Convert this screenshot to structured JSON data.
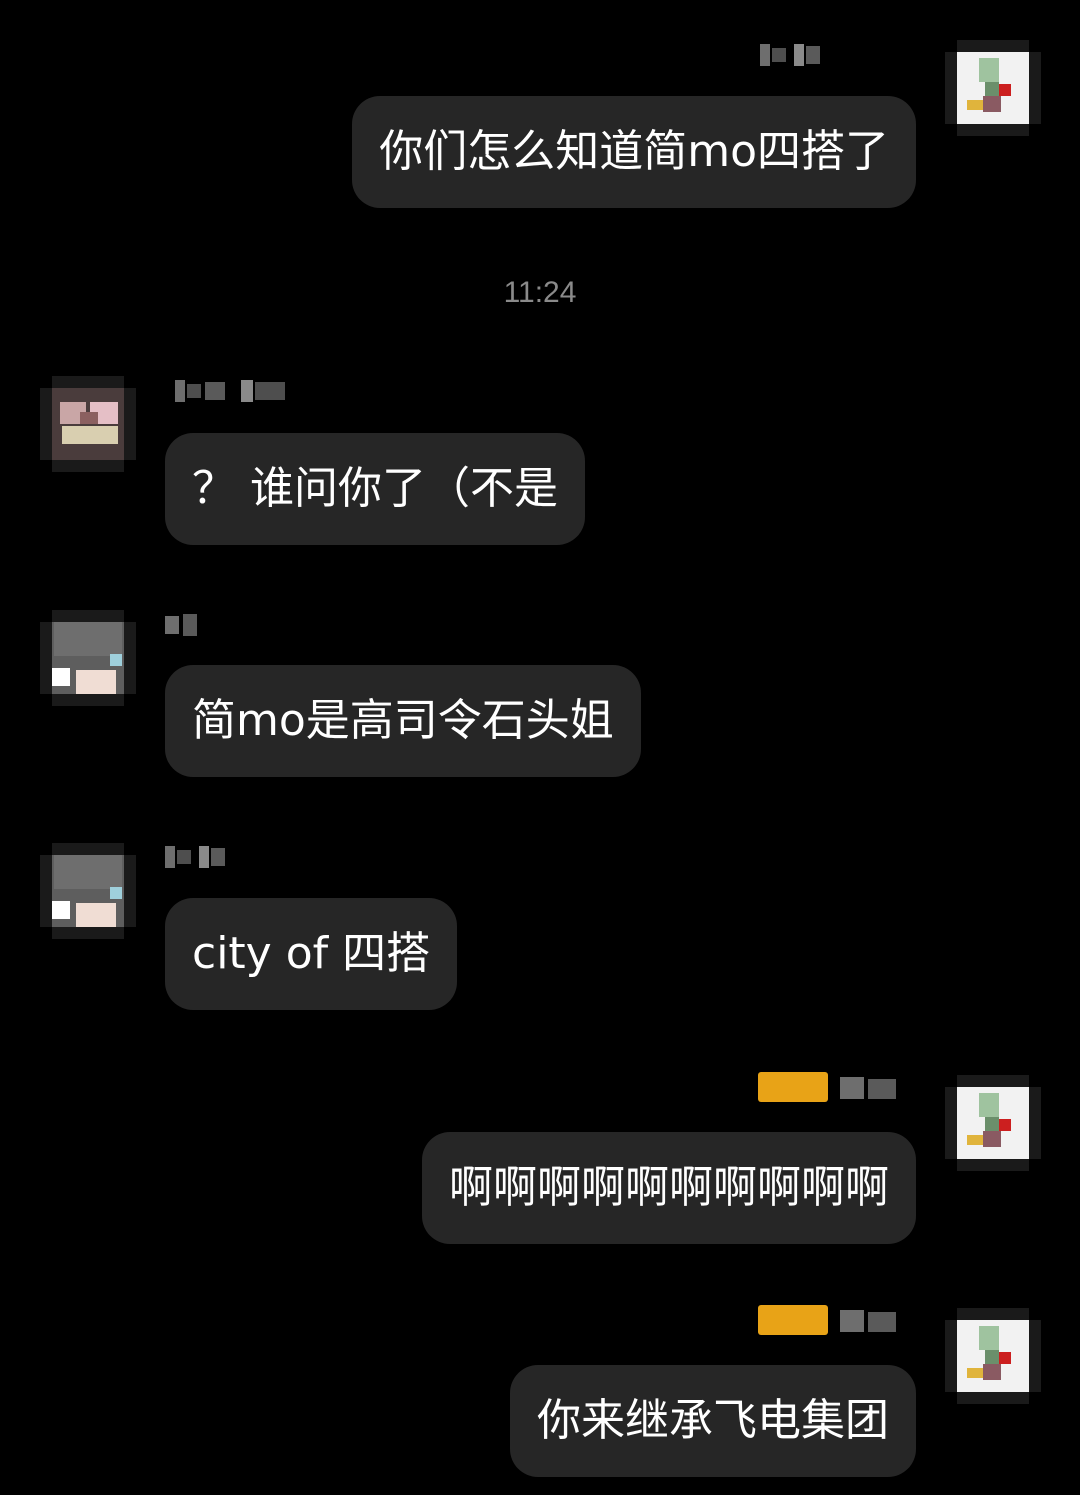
{
  "timestamp": "11:24",
  "colors": {
    "background": "#000000",
    "bubble": "#262626",
    "text": "#ffffff",
    "timestamp": "#8a8a8a",
    "badge": "#e8a317"
  },
  "messages": [
    {
      "side": "right",
      "avatar_icon": "self-avatar-icon",
      "text": "你们怎么知道简mo四搭了"
    },
    {
      "side": "left",
      "avatar_icon": "pink-avatar-icon",
      "text": "？ 谁问你了（不是"
    },
    {
      "side": "left",
      "avatar_icon": "grey-avatar-icon",
      "text": "简mo是高司令石头姐"
    },
    {
      "side": "left",
      "avatar_icon": "grey-avatar-icon",
      "text": "city of 四搭"
    },
    {
      "side": "right",
      "avatar_icon": "self-avatar-icon",
      "badge_icon": "level-badge-icon",
      "text": "啊啊啊啊啊啊啊啊啊啊"
    },
    {
      "side": "right",
      "avatar_icon": "self-avatar-icon",
      "badge_icon": "level-badge-icon",
      "text": "你来继承飞电集团"
    }
  ]
}
